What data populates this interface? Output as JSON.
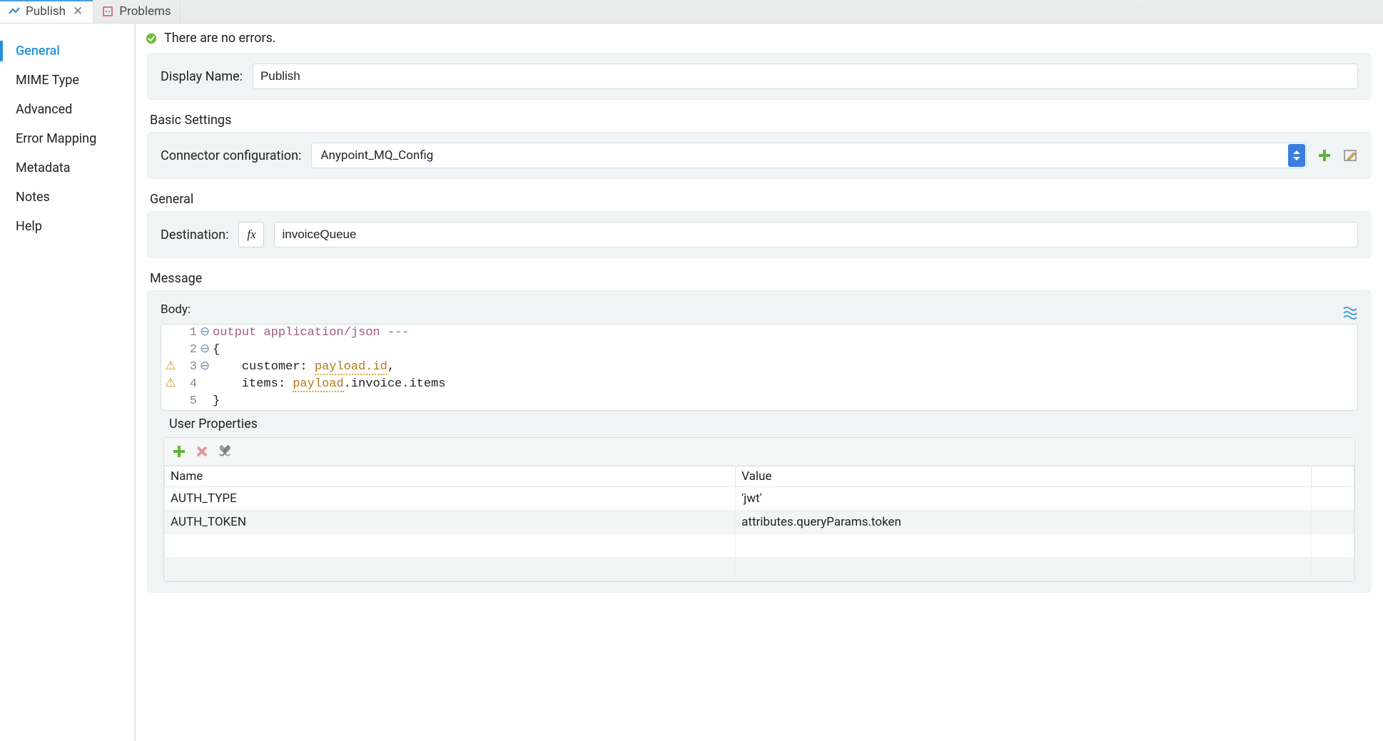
{
  "tabs": {
    "publish": "Publish",
    "problems": "Problems"
  },
  "sidebar": {
    "items": [
      {
        "id": "general",
        "label": "General"
      },
      {
        "id": "mime",
        "label": "MIME Type"
      },
      {
        "id": "advanced",
        "label": "Advanced"
      },
      {
        "id": "errormap",
        "label": "Error Mapping"
      },
      {
        "id": "metadata",
        "label": "Metadata"
      },
      {
        "id": "notes",
        "label": "Notes"
      },
      {
        "id": "help",
        "label": "Help"
      }
    ]
  },
  "status": {
    "text": "There are no errors."
  },
  "form": {
    "displayName": {
      "label": "Display Name:",
      "value": "Publish"
    },
    "basicSettings": {
      "title": "Basic Settings",
      "connectorLabel": "Connector configuration:",
      "connectorValue": "Anypoint_MQ_Config"
    },
    "general": {
      "title": "General",
      "destinationLabel": "Destination:",
      "fx": "fx",
      "destinationValue": "invoiceQueue"
    },
    "message": {
      "title": "Message",
      "bodyLabel": "Body:",
      "userPropsTitle": "User Properties",
      "code": {
        "l1_a": "output application/json ---",
        "l2_a": "{",
        "l3_a": "    customer: ",
        "l3_b": "payload.id",
        "l3_c": ",",
        "l4_a": "    items: ",
        "l4_b": "payload",
        "l4_c": ".invoice.items",
        "l5_a": "}"
      },
      "table": {
        "headers": {
          "name": "Name",
          "value": "Value"
        },
        "rows": [
          {
            "name": "AUTH_TYPE",
            "value": "'jwt'"
          },
          {
            "name": "AUTH_TOKEN",
            "value": "attributes.queryParams.token"
          }
        ]
      }
    }
  }
}
